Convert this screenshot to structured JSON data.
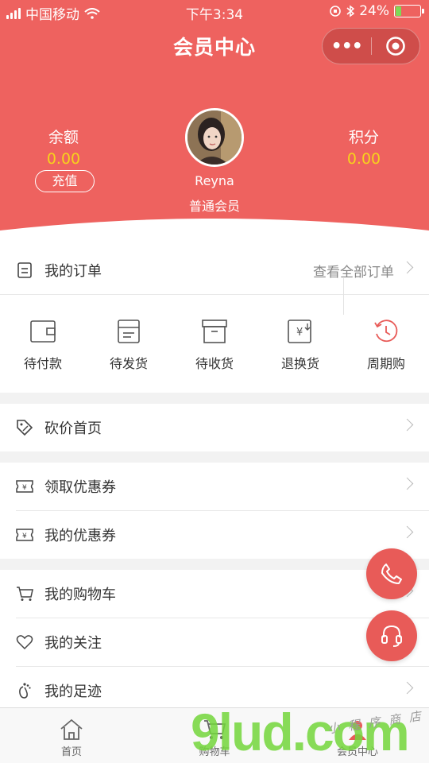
{
  "status": {
    "carrier": "中国移动",
    "time": "下午3:34",
    "battery": "24%",
    "battery_level": 0.24
  },
  "header": {
    "title": "会员中心",
    "more_icon": "•••",
    "capsule_close_icon": "target-circle-icon"
  },
  "balance": {
    "label": "余额",
    "value": "0.00",
    "recharge": "充值"
  },
  "points": {
    "label": "积分",
    "value": "0.00"
  },
  "user": {
    "name": "Reyna",
    "level": "普通会员"
  },
  "my_orders": {
    "label": "我的订单",
    "view_all": "查看全部订单"
  },
  "order_status": [
    {
      "label": "待付款",
      "icon": "wallet-icon"
    },
    {
      "label": "待发货",
      "icon": "box-icon"
    },
    {
      "label": "待收货",
      "icon": "package-icon"
    },
    {
      "label": "退换货",
      "icon": "refund-icon"
    },
    {
      "label": "周期购",
      "icon": "cycle-clock-icon"
    }
  ],
  "menu": {
    "bargain": "砍价首页",
    "get_coupon": "领取优惠券",
    "my_coupon": "我的优惠券",
    "cart": "我的购物车",
    "follow": "我的关注",
    "footprint": "我的足迹"
  },
  "tabs": [
    {
      "label": "首页",
      "icon": "home-icon"
    },
    {
      "label": "购物车",
      "icon": "cart-icon"
    },
    {
      "label": "会员中心",
      "icon": "member-icon"
    }
  ],
  "watermark": {
    "text": "9lud.com",
    "sub": "小 程 序 商 店"
  },
  "colors": {
    "accent": "#ee625f",
    "gold": "#f7d21c"
  }
}
